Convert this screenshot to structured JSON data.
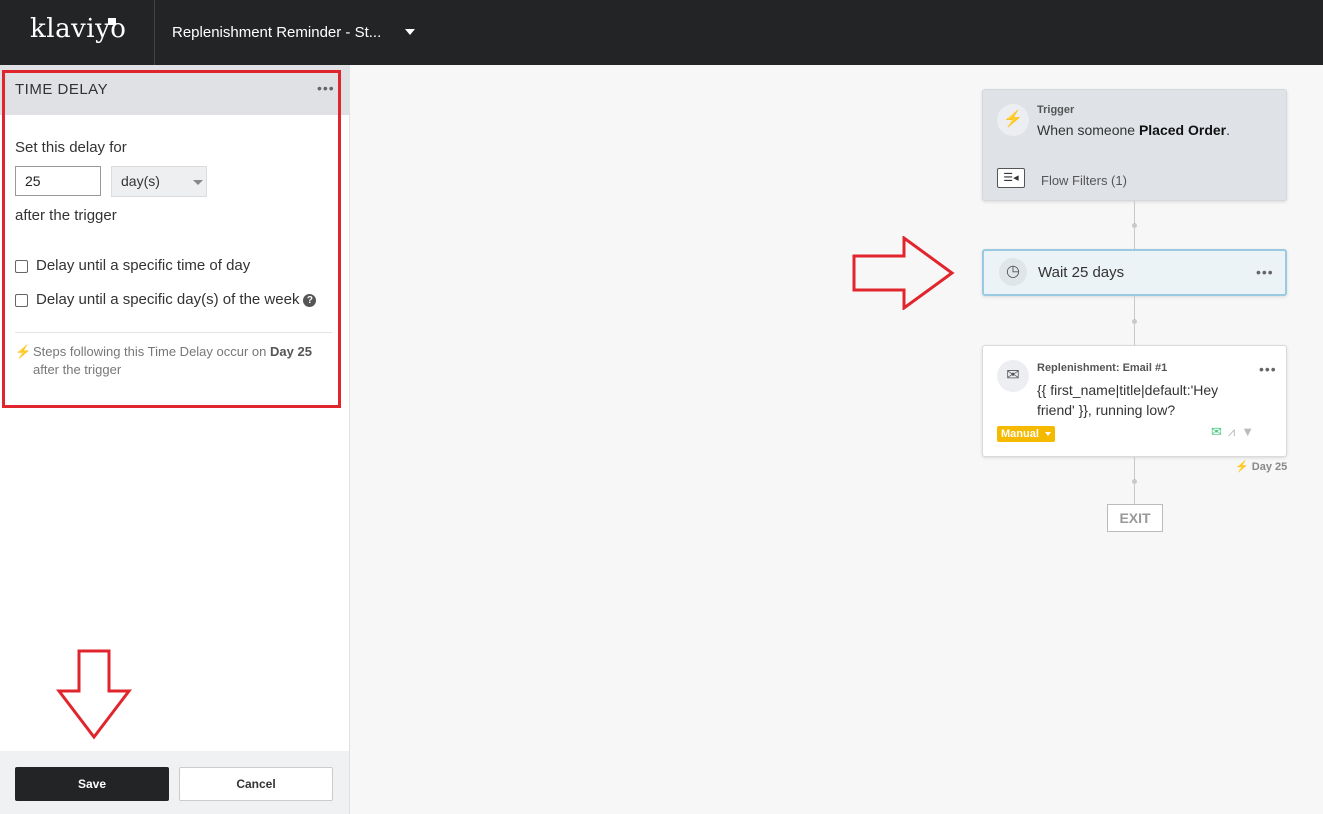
{
  "topbar": {
    "logo": "klaviyo",
    "flow_title": "Replenishment Reminder - St..."
  },
  "panel": {
    "title": "TIME DELAY",
    "set_label": "Set this delay for",
    "delay_value": "25",
    "unit": "day(s)",
    "after_label": "after the trigger",
    "checkbox_time": "Delay until a specific time of day",
    "checkbox_week": "Delay until a specific day(s) of the week",
    "info_prefix": "Steps following this Time Delay occur on ",
    "info_day": "Day 25",
    "info_suffix": "after the trigger",
    "save_label": "Save",
    "cancel_label": "Cancel"
  },
  "flow": {
    "trigger_label": "Trigger",
    "trigger_prefix": "When someone ",
    "trigger_event": "Placed Order",
    "trigger_suffix": ".",
    "filters_label": "Flow Filters (1)",
    "wait_label": "Wait 25 days",
    "email_label": "Replenishment: Email #1",
    "email_subject": "{{ first_name|title|default:'Hey friend' }}, running low?",
    "manual_badge": "Manual",
    "day_badge": "Day 25",
    "exit_label": "EXIT"
  },
  "colors": {
    "topbar": "#232426",
    "highlight": "#e1252d",
    "manual_badge": "#f5b900",
    "wait_border": "#9ac9e2"
  },
  "icons": [
    "lightning-icon",
    "filter-list-icon",
    "clock-icon",
    "envelope-icon",
    "help-icon",
    "chevron-down-icon",
    "ellipsis-icon"
  ]
}
